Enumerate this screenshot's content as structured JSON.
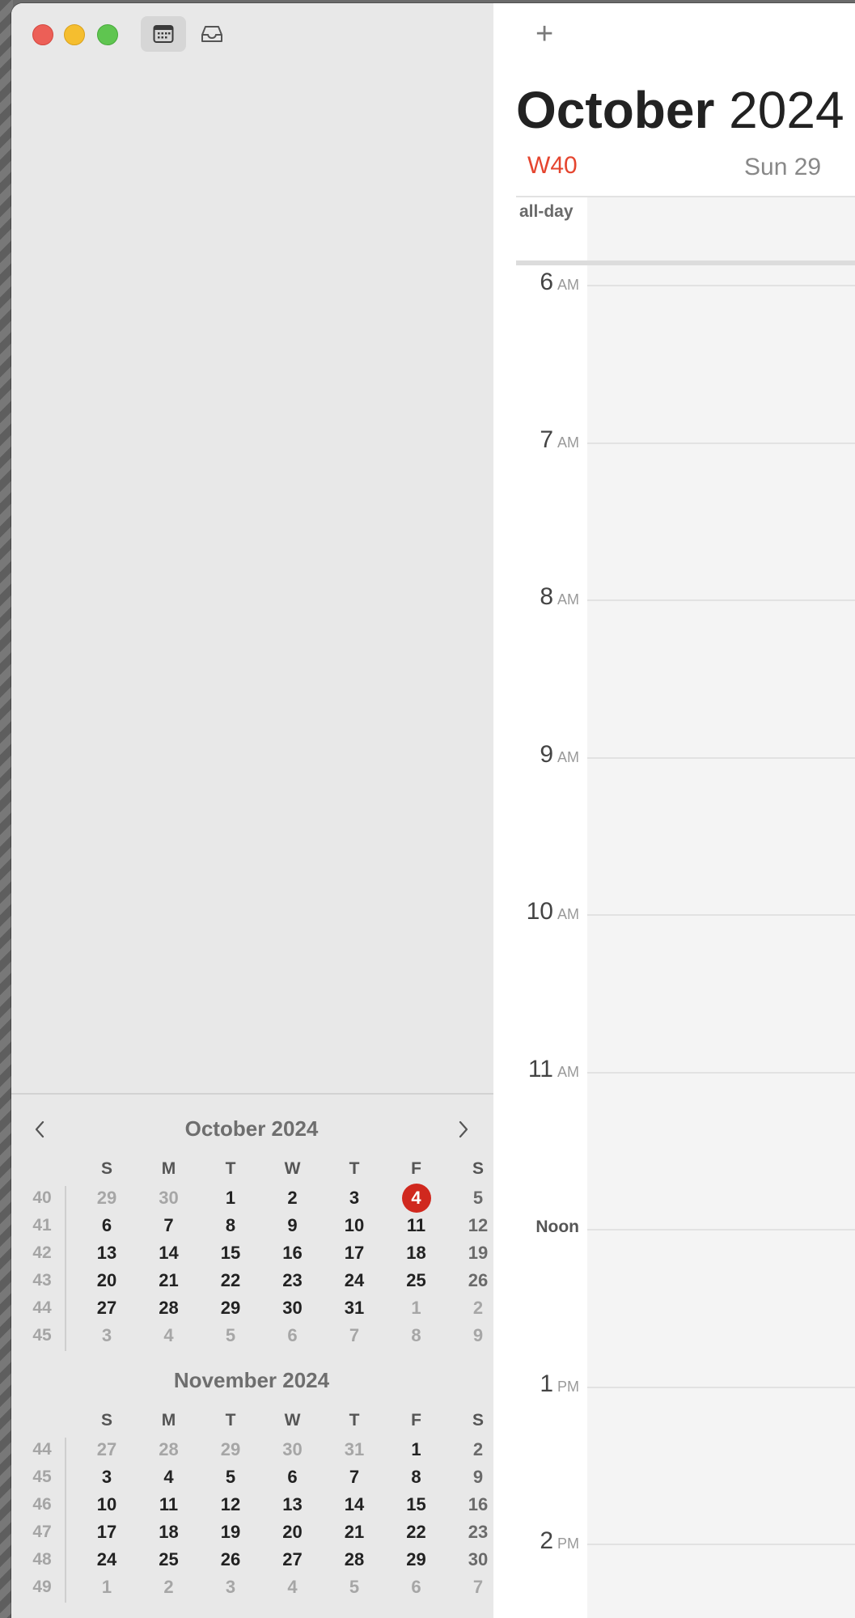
{
  "toolbar": {
    "add_label": "+"
  },
  "header": {
    "month": "October",
    "year": "2024",
    "week": "W40",
    "day_label": "Sun 29"
  },
  "allday_label": "all-day",
  "hours": [
    {
      "n": "6",
      "ap": "AM"
    },
    {
      "n": "7",
      "ap": "AM"
    },
    {
      "n": "8",
      "ap": "AM"
    },
    {
      "n": "9",
      "ap": "AM"
    },
    {
      "n": "10",
      "ap": "AM"
    },
    {
      "n": "11",
      "ap": "AM"
    },
    {
      "n": "Noon",
      "ap": ""
    },
    {
      "n": "1",
      "ap": "PM"
    },
    {
      "n": "2",
      "ap": "PM"
    }
  ],
  "minicals": [
    {
      "title": "October 2024",
      "dow": [
        "S",
        "M",
        "T",
        "W",
        "T",
        "F",
        "S"
      ],
      "weeks": [
        {
          "wk": "40",
          "days": [
            [
              "29",
              "o"
            ],
            [
              "30",
              "o"
            ],
            [
              "1",
              "c"
            ],
            [
              "2",
              "c"
            ],
            [
              "3",
              "c"
            ],
            [
              "4",
              "t"
            ],
            [
              "5",
              "w"
            ]
          ]
        },
        {
          "wk": "41",
          "days": [
            [
              "6",
              "c"
            ],
            [
              "7",
              "c"
            ],
            [
              "8",
              "c"
            ],
            [
              "9",
              "c"
            ],
            [
              "10",
              "c"
            ],
            [
              "11",
              "c"
            ],
            [
              "12",
              "w"
            ]
          ]
        },
        {
          "wk": "42",
          "days": [
            [
              "13",
              "c"
            ],
            [
              "14",
              "c"
            ],
            [
              "15",
              "c"
            ],
            [
              "16",
              "c"
            ],
            [
              "17",
              "c"
            ],
            [
              "18",
              "c"
            ],
            [
              "19",
              "w"
            ]
          ]
        },
        {
          "wk": "43",
          "days": [
            [
              "20",
              "c"
            ],
            [
              "21",
              "c"
            ],
            [
              "22",
              "c"
            ],
            [
              "23",
              "c"
            ],
            [
              "24",
              "c"
            ],
            [
              "25",
              "c"
            ],
            [
              "26",
              "w"
            ]
          ]
        },
        {
          "wk": "44",
          "days": [
            [
              "27",
              "c"
            ],
            [
              "28",
              "c"
            ],
            [
              "29",
              "c"
            ],
            [
              "30",
              "c"
            ],
            [
              "31",
              "c"
            ],
            [
              "1",
              "o"
            ],
            [
              "2",
              "o"
            ]
          ]
        },
        {
          "wk": "45",
          "days": [
            [
              "3",
              "o"
            ],
            [
              "4",
              "o"
            ],
            [
              "5",
              "o"
            ],
            [
              "6",
              "o"
            ],
            [
              "7",
              "o"
            ],
            [
              "8",
              "o"
            ],
            [
              "9",
              "o"
            ]
          ]
        }
      ]
    },
    {
      "title": "November 2024",
      "dow": [
        "S",
        "M",
        "T",
        "W",
        "T",
        "F",
        "S"
      ],
      "weeks": [
        {
          "wk": "44",
          "days": [
            [
              "27",
              "o"
            ],
            [
              "28",
              "o"
            ],
            [
              "29",
              "o"
            ],
            [
              "30",
              "o"
            ],
            [
              "31",
              "o"
            ],
            [
              "1",
              "c"
            ],
            [
              "2",
              "w"
            ]
          ]
        },
        {
          "wk": "45",
          "days": [
            [
              "3",
              "c"
            ],
            [
              "4",
              "c"
            ],
            [
              "5",
              "c"
            ],
            [
              "6",
              "c"
            ],
            [
              "7",
              "c"
            ],
            [
              "8",
              "c"
            ],
            [
              "9",
              "w"
            ]
          ]
        },
        {
          "wk": "46",
          "days": [
            [
              "10",
              "c"
            ],
            [
              "11",
              "c"
            ],
            [
              "12",
              "c"
            ],
            [
              "13",
              "c"
            ],
            [
              "14",
              "c"
            ],
            [
              "15",
              "c"
            ],
            [
              "16",
              "w"
            ]
          ]
        },
        {
          "wk": "47",
          "days": [
            [
              "17",
              "c"
            ],
            [
              "18",
              "c"
            ],
            [
              "19",
              "c"
            ],
            [
              "20",
              "c"
            ],
            [
              "21",
              "c"
            ],
            [
              "22",
              "c"
            ],
            [
              "23",
              "w"
            ]
          ]
        },
        {
          "wk": "48",
          "days": [
            [
              "24",
              "c"
            ],
            [
              "25",
              "c"
            ],
            [
              "26",
              "c"
            ],
            [
              "27",
              "c"
            ],
            [
              "28",
              "c"
            ],
            [
              "29",
              "c"
            ],
            [
              "30",
              "w"
            ]
          ]
        },
        {
          "wk": "49",
          "days": [
            [
              "1",
              "o"
            ],
            [
              "2",
              "o"
            ],
            [
              "3",
              "o"
            ],
            [
              "4",
              "o"
            ],
            [
              "5",
              "o"
            ],
            [
              "6",
              "o"
            ],
            [
              "7",
              "o"
            ]
          ]
        }
      ]
    }
  ],
  "colors": {
    "today": "#d0281e",
    "week_label": "#e5452f",
    "sidebar_bg": "#e8e8e8"
  },
  "icons": [
    "close-window-icon",
    "minimize-window-icon",
    "zoom-window-icon",
    "calendar-icon",
    "inbox-icon",
    "plus-icon",
    "chevron-left-icon",
    "chevron-right-icon"
  ]
}
